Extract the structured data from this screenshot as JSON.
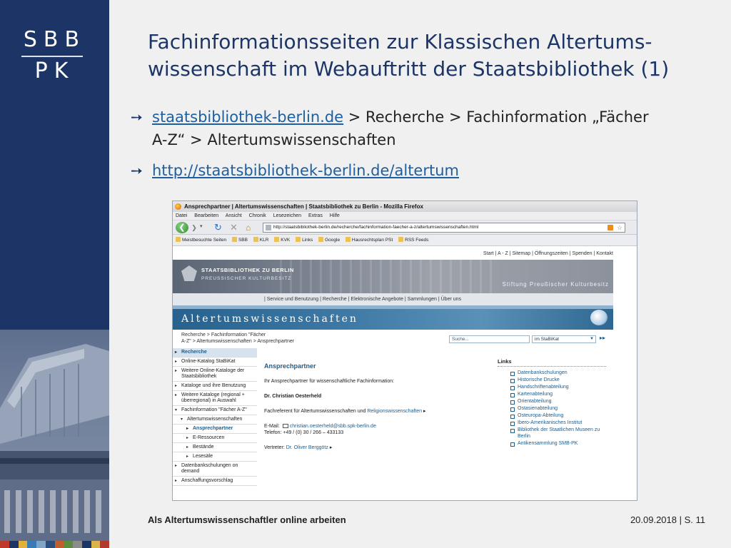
{
  "branding": {
    "logo_line1": "SBB",
    "logo_line2": "PK",
    "color_bar": [
      "#c0392b",
      "#1c3566",
      "#e2b13c",
      "#3a7bb6",
      "#7fa6c8",
      "#2c4f7c",
      "#c25e2b",
      "#5b8f3e",
      "#8c8c8c",
      "#1c3566",
      "#d9b44a",
      "#b03a2e"
    ]
  },
  "slide": {
    "title_line1": "Fachinformationsseiten zur Klassischen Altertums-",
    "title_line2": "wissenschaft im Webauftritt der Staatsbibliothek (1)",
    "bullet_icon": "circled-arrow-icon",
    "bullet1_link": "staatsbibliothek-berlin.de",
    "bullet1_text_a": " > Recherche > Fachinformation „Fächer",
    "bullet1_text_b": "A-Z“ > Altertumswissenschaften",
    "bullet2_link": "http://staatsbibliothek-berlin.de/altertum"
  },
  "browser": {
    "window_title": "Ansprechpartner | Altertumswissenschaften | Staatsbibliothek zu Berlin - Mozilla Firefox",
    "menu": [
      "Datei",
      "Bearbeiten",
      "Ansicht",
      "Chronik",
      "Lesezeichen",
      "Extras",
      "Hilfe"
    ],
    "url": "http://staatsbibliothek-berlin.de/recherche/fachinformation-faecher-a-z/altertumswissenschaften.html",
    "bookmarks": [
      "Meistbesuchte Seiten",
      "SBB",
      "KLR",
      "KVK",
      "Links",
      "Google",
      "Hausrechtsplan PSt",
      "RSS Feeds"
    ]
  },
  "webpage": {
    "utility_nav": "Start | A - Z | Sitemap | Öffnungszeiten | Spenden | Kontakt",
    "org_name": "STAATSBIBLIOTHEK ZU BERLIN",
    "org_sub": "PREUSSISCHER KULTURBESITZ",
    "stiftung": "Stiftung Preußischer Kulturbesitz",
    "main_nav": "| Service und Benutzung | Recherche | Elektronische Angebote | Sammlungen | Über uns",
    "banner_title": "Altertumswissenschaften",
    "breadcrumb_line1": "Recherche > Fachinformation \"Fächer",
    "breadcrumb_line2": "A-Z\" > Altertumswissenschaften > Ansprechpartner",
    "search_placeholder": "Suche...",
    "search_scope": "im StaBiKat",
    "sidenav": {
      "recherche": "Recherche",
      "stabikat": "Online-Katalog StaBiKat",
      "weitere_online": "Weitere Online-Kataloge der Staatsbibliothek",
      "kataloge_benutzung": "Kataloge und ihre Benutzung",
      "weitere_kataloge": "Weitere Kataloge (regional + überregional) in Auswahl",
      "fachinformation": "Fachinformation \"Fächer A-Z\"",
      "altertum": "Altertumswissenschaften",
      "ansprechpartner": "Ansprechpartner",
      "e_ressourcen": "E-Ressourcen",
      "bestaende": "Bestände",
      "lesesaele": "Lesesäle",
      "datenbankschulungen": "Datenbankschulungen on demand",
      "anschaffung": "Anschaffungsvorschlag"
    },
    "content": {
      "heading": "Ansprechpartner",
      "intro": "Ihr Ansprechpartner für wissenschaftliche Fachinformation:",
      "name": "Dr. Christian Oesterheld",
      "role": "Fachreferent für Altertumswissenschaften und ",
      "role_link": "Religionswissenschaften",
      "email_label": "E-Mail:",
      "email": "christian.oesterheld@sbb.spk-berlin.de",
      "phone": "Telefon: +49 / (0) 30 / 266 – 433133",
      "deputy_label": "Vertreter: ",
      "deputy": "Dr. Oliver Berggötz"
    },
    "links": {
      "heading": "Links",
      "items": [
        "Datenbankschulungen",
        "Historische Drucke",
        "Handschriftenabteilung",
        "Kartenabteilung",
        "Orientabteilung",
        "Ostasienabteilung",
        "Osteuropa-Abteilung",
        "Ibero-Amerikanisches Institut",
        "Bibliothek der Staatlichen Museen zu Berlin",
        "Antikensammlung SMB-PK"
      ]
    }
  },
  "footer": {
    "left": "Als Altertumswissenschaftler online arbeiten",
    "right": "20.09.2018 | S. 11"
  }
}
